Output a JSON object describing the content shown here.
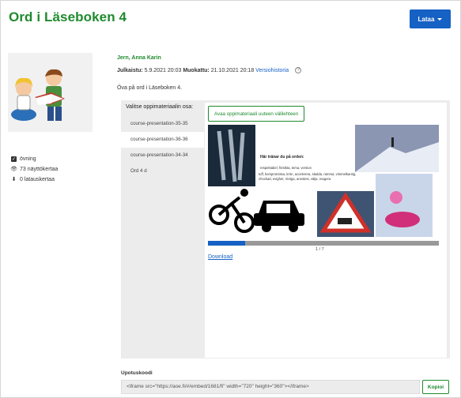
{
  "page": {
    "title": "Ord i Läseboken 4"
  },
  "header": {
    "download_label": "Lataa"
  },
  "sidebar": {
    "tag": "övning",
    "views": "73 näyttökertaa",
    "downloads": "0 latauskertaa"
  },
  "meta": {
    "author": "Jern, Anna Karin",
    "published_label": "Julkaistu:",
    "published": "5.9.2021 20:03",
    "modified_label": "Muokattu:",
    "modified": "21.10.2021 20:18",
    "version_history": "Versiohistoria",
    "help": "?",
    "description": "Öva på ord i Läseboken 4."
  },
  "material": {
    "label": "Valitse oppimateriaalin osa:",
    "items": [
      {
        "label": "course-presentation-35-35"
      },
      {
        "label": "course-presentation-36-36"
      },
      {
        "label": "course-presentation-34-34"
      },
      {
        "label": "Ord 4 d"
      }
    ],
    "selected_index": 1,
    "open_button": "Avaa oppimateriaali uuteen välilehteen"
  },
  "presentation": {
    "heading": "Här tränar du på orden:",
    "line1": "respektabel, försikta, tema, version",
    "line2": "tuff, kompromissa, krön, accelerera, sladda, ramma, vimmelkantig, chockad, evighet, röntga, anestesi, välja, reagera",
    "page_indicator": "1 / 7",
    "progress_fraction": 0.16,
    "download_link": "Download"
  },
  "embed": {
    "label": "Upotuskoodi",
    "code": "<iframe src=\"https://aoe.fi/#/embed/1681/fi\" width=\"720\" height=\"360\"></iframe>",
    "copy_label": "Kopioi"
  },
  "colors": {
    "accent_green": "#1f8a2e",
    "primary_blue": "#1661c4"
  },
  "icons": {
    "tag": "checkbox-icon",
    "views": "eye-icon",
    "downloads": "download-icon",
    "caret": "caret-down-icon"
  }
}
